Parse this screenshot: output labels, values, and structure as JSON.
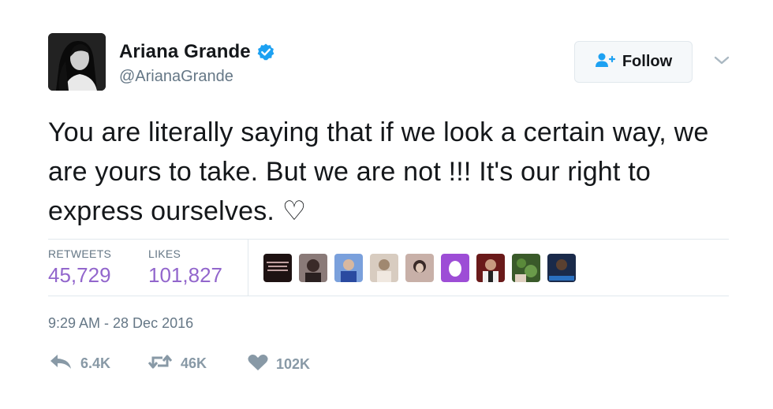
{
  "author": {
    "name": "Ariana Grande",
    "handle": "@ArianaGrande",
    "verified": true,
    "avatar_icon": "profile-photo"
  },
  "follow_button": {
    "label": "Follow",
    "icon": "add-user-icon"
  },
  "menu_icon": "chevron-down-icon",
  "tweet": {
    "text": "You are literally saying that if we look a certain way, we are yours to take. But we are not !!! It's our right to express ourselves. ♡"
  },
  "stats": {
    "retweets_label": "RETWEETS",
    "retweets_value": "45,729",
    "likes_label": "LIKES",
    "likes_value": "101,827"
  },
  "likers": [
    {
      "icon": "liker-avatar-1",
      "color": "#2a1a1a"
    },
    {
      "icon": "liker-avatar-2",
      "color": "#5a4a48"
    },
    {
      "icon": "liker-avatar-3",
      "color": "#6a8ccc"
    },
    {
      "icon": "liker-avatar-4",
      "color": "#c8b8a8"
    },
    {
      "icon": "liker-avatar-5",
      "color": "#b8a098"
    },
    {
      "icon": "liker-avatar-egg",
      "color": "#9d4dd6"
    },
    {
      "icon": "liker-avatar-7",
      "color": "#7a2a2a"
    },
    {
      "icon": "liker-avatar-8",
      "color": "#4a6a3a"
    },
    {
      "icon": "liker-avatar-9",
      "color": "#3a4a6a"
    }
  ],
  "timestamp": "9:29 AM - 28 Dec 2016",
  "actions": {
    "reply_count": "6.4K",
    "retweet_count": "46K",
    "like_count": "102K"
  },
  "colors": {
    "stat_value": "#9266cc",
    "muted": "#657786",
    "verified": "#1da1f2",
    "action": "#8899a6"
  }
}
